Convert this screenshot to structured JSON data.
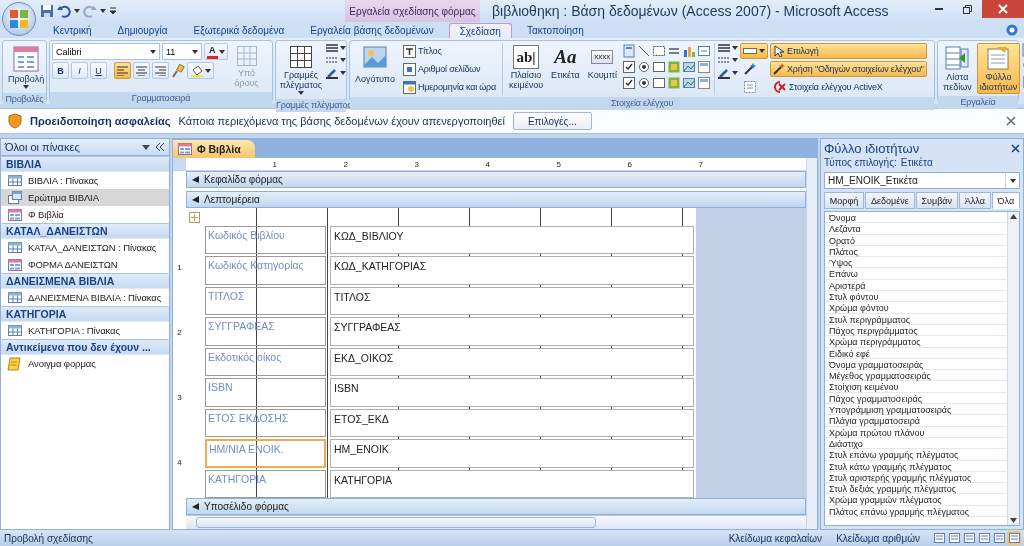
{
  "title_bar": {
    "contextual_tab": "Εργαλεία σχεδίασης φόρμας",
    "title": "βιβλιοθηκη : Βάση δεδομένων (Access 2007) - Microsoft Access"
  },
  "ribbon_tabs": [
    {
      "label": "Κεντρική",
      "selected": false
    },
    {
      "label": "Δημιουργία",
      "selected": false
    },
    {
      "label": "Εξωτερικά δεδομένα",
      "selected": false
    },
    {
      "label": "Εργαλεία βάσης δεδομένων",
      "selected": false
    },
    {
      "label": "Σχεδίαση",
      "selected": true
    },
    {
      "label": "Τακτοποίηση",
      "selected": false
    }
  ],
  "ribbon": {
    "views": {
      "label": "Προβολές",
      "button": "Προβολή"
    },
    "font": {
      "label": "Γραμματοσειρά",
      "font_name": "Calibri",
      "font_size": "11",
      "font_color_glyph": "A",
      "style_buttons": [
        "B",
        "I",
        "U"
      ],
      "alignment": [
        {
          "kind": "left",
          "selected": true
        },
        {
          "kind": "center",
          "selected": false
        },
        {
          "kind": "right",
          "selected": false
        }
      ],
      "conditional": {
        "label": "Υπό όρους",
        "disabled": true
      }
    },
    "gridlines": {
      "label": "Γραμμές πλέγματος",
      "button": "Γραμμές πλέγματος"
    },
    "controls": {
      "label": "Στοιχεία ελέγχου",
      "logo": "Λογότυπο",
      "header_footer": [
        {
          "kind": "title",
          "label": "Τίτλος"
        },
        {
          "kind": "page-numbers",
          "label": "Αριθμοί σελίδων"
        },
        {
          "kind": "date-time",
          "label": "Ημερομηνία και ώρα"
        }
      ],
      "big_buttons": [
        {
          "label": "Πλαίσιο κειμένου",
          "glyph": "ab|"
        },
        {
          "label": "Ετικέτα",
          "glyph": "Aa"
        },
        {
          "label": "Κουμπί",
          "glyph": "xxxx"
        }
      ],
      "small_tools": [
        {
          "kind": "effect",
          "selected": true
        },
        {
          "kind": "wizard",
          "selected": false
        },
        {
          "kind": "tab-order",
          "selected": false
        }
      ],
      "options": [
        {
          "kind": "select",
          "label": "Επιλογή",
          "selected": true
        },
        {
          "kind": "wizards",
          "label": "Χρήση \"Οδηγών στοιχείων ελέγχου\"",
          "selected": true
        },
        {
          "kind": "activex",
          "label": "Στοιχεία ελέγχου ActiveX",
          "selected": false
        }
      ]
    },
    "tools": {
      "label": "Εργαλεία",
      "buttons": [
        {
          "label": "Λίστα πεδίων",
          "selected": false
        },
        {
          "label": "Φύλλο ιδιοτήτων",
          "selected": true
        }
      ]
    }
  },
  "message_bar": {
    "title": "Προειδοποίηση ασφαλείας",
    "text": "Κάποια περιεχόμενα της βάσης δεδομένων έχουν απενεργοποιηθεί",
    "button": "Επιλογές..."
  },
  "nav_pane": {
    "title": "Όλοι οι πίνακες",
    "groups": [
      {
        "title": "ΒΙΒΛΙΑ",
        "items": [
          {
            "kind": "table",
            "label": "ΒΙΒΛΙΑ : Πίνακας",
            "selected": false
          },
          {
            "kind": "query",
            "label": "Ερώτημα ΒΙΒΛΙΑ",
            "selected": true
          },
          {
            "kind": "form",
            "label": "Φ Βιβλία",
            "selected": false
          }
        ]
      },
      {
        "title": "ΚΑΤΑΛ_ΔΑΝΕΙΣΤΩΝ",
        "items": [
          {
            "kind": "table",
            "label": "ΚΑΤΑΛ_ΔΑΝΕΙΣΤΩΝ : Πίνακας",
            "selected": false
          },
          {
            "kind": "form",
            "label": "ΦΟΡΜΑ ΔΑΝΕΙΣΤΩΝ",
            "selected": false
          }
        ]
      },
      {
        "title": "ΔΑΝΕΙΣΜΕΝΑ ΒΙΒΛΙΑ",
        "items": [
          {
            "kind": "table",
            "label": "ΔΑΝΕΙΣΜΕΝΑ ΒΙΒΛΙΑ : Πίνακας",
            "selected": false
          }
        ]
      },
      {
        "title": "ΚΑΤΗΓΟΡΙΑ",
        "items": [
          {
            "kind": "table",
            "label": "ΚΑΤΗΓΟΡΙΑ : Πίνακας",
            "selected": false
          }
        ]
      },
      {
        "title": "Αντικείμενα που δεν έχουν ...",
        "items": [
          {
            "kind": "macro",
            "label": "Ανοιγμα φορμας",
            "selected": false
          }
        ]
      }
    ]
  },
  "document": {
    "tab": "Φ Βιβλία",
    "ruler": {
      "horizontal": [
        "1",
        "2",
        "3",
        "4",
        "5",
        "6",
        "7"
      ],
      "vertical": [
        "1",
        "2",
        "3",
        "4"
      ]
    },
    "form_header": "Κεφαλίδα φόρμας",
    "detail": "Λεπτομέρεια",
    "form_footer": "Υποσέλιδο φόρμας",
    "fields": [
      {
        "label": "Κωδικός Βιβλίου",
        "value": "ΚΩΔ_ΒΙΒΛΙΟΥ",
        "selected": false
      },
      {
        "label": "Κωδικός Κατηγορίας",
        "value": "ΚΩΔ_ΚΑΤΗΓΟΡΙΑΣ",
        "selected": false
      },
      {
        "label": "ΤΙΤΛΟΣ",
        "value": "ΤΙΤΛΟΣ",
        "selected": false
      },
      {
        "label": "ΣΥΓΓΡΑΦΕΑΣ",
        "value": "ΣΥΓΓΡΑΦΕΑΣ",
        "selected": false
      },
      {
        "label": "Εκδοτικός οίκος",
        "value": "ΕΚΔ_ΟΙΚΟΣ",
        "selected": false
      },
      {
        "label": "ISBN",
        "value": "ISBN",
        "selected": false
      },
      {
        "label": "ΕΤΟΣ ΕΚΔΟΣΗΣ",
        "value": "ΕΤΟΣ_ΕΚΔ",
        "selected": false
      },
      {
        "label": "ΗΜ/ΝΙΑ ΕΝΟΙΚ.",
        "value": "ΗΜ_ΕΝΟΙΚ",
        "selected": true
      },
      {
        "label": "ΚΑΤΗΓΟΡΙΑ",
        "value": "ΚΑΤΗΓΟΡΙΑ",
        "selected": false
      }
    ]
  },
  "property_sheet": {
    "title": "Φύλλο ιδιοτήτων",
    "selection_type_label": "Τύπος επιλογής:",
    "selection_type": "Ετικέτα",
    "object": "ΗΜ_ΕΝΟΙΚ_Ετικέτα",
    "tabs": [
      {
        "label": "Μορφή",
        "selected": false
      },
      {
        "label": "Δεδομένε",
        "selected": false
      },
      {
        "label": "Συμβάν",
        "selected": false
      },
      {
        "label": "Άλλα",
        "selected": false
      },
      {
        "label": "Όλα",
        "selected": true
      }
    ],
    "properties": [
      "Όνομα",
      "Λεζάντα",
      "Ορατό",
      "Πλάτος",
      "Ύψος",
      "Επάνω",
      "Αριστερά",
      "Στυλ φόντου",
      "Χρώμα φόντου",
      "Στυλ περιγράμματος",
      "Πάχος περιγράμματος",
      "Χρώμα περιγράμματος",
      "Ειδικό εφέ",
      "Όνομα γραμματοσειράς",
      "Μέγεθος γραμματοσειράς",
      "Στοίχιση κειμένου",
      "Πάχος γραμματοσειράς",
      "Υπογράμμιση γραμματοσειράς",
      "Πλάγια γραμματοσειρά",
      "Χρώμα πρώτου πλάνου",
      "Διάστιχο",
      "Στυλ επάνω γραμμής πλέγματος",
      "Στυλ κάτω γραμμής πλέγματος",
      "Στυλ αριστερής γραμμής πλέγματος",
      "Στυλ δεξιάς γραμμής πλέγματος",
      "Χρώμα γραμμών πλέγματος",
      "Πλάτος επάνω γραμμής πλέγματος"
    ]
  },
  "status_bar": {
    "view": "Προβολή σχεδίασης",
    "indicators": [
      "Κλείδωμα κεφαλαίων",
      "Κλείδωμα αριθμών"
    ],
    "view_buttons": [
      {
        "selected": false
      },
      {
        "selected": false
      },
      {
        "selected": false
      },
      {
        "selected": false
      },
      {
        "selected": false
      },
      {
        "selected": true
      }
    ]
  }
}
